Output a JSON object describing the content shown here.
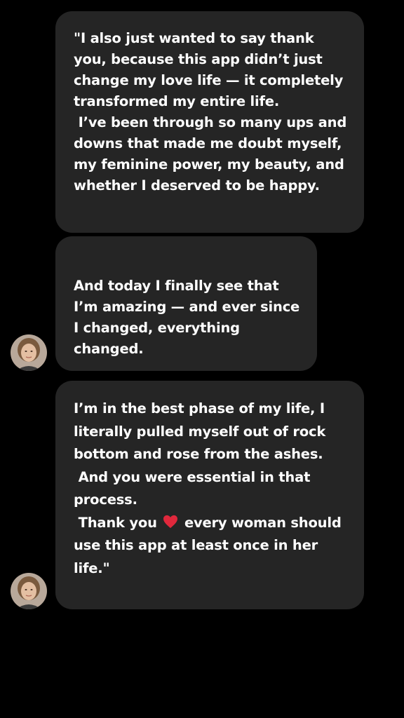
{
  "messages": [
    {
      "text": "\"I also just wanted to say thank you, because this app didn’t just change my love life — it completely transformed my entire life.\n I’ve been through so many ups and downs that made me doubt myself, my feminine power, my beauty, and whether I deserved to be happy."
    },
    {
      "text": "And today I finally see that I’m amazing — and ever since I changed, everything changed."
    },
    {
      "text_before_heart": "I’m in the best phase of my life, I literally pulled myself out of rock bottom and rose from the ashes.\n And you were essential in that process.\n Thank you ",
      "heart_icon": "red-heart-emoji",
      "text_after_heart": " every woman should use this app at least once in her life.\""
    }
  ],
  "colors": {
    "background": "#000000",
    "bubble": "#252525",
    "text": "#ffffff",
    "heart": "#e0283c"
  },
  "avatar": {
    "icon": "user-avatar-photo"
  }
}
